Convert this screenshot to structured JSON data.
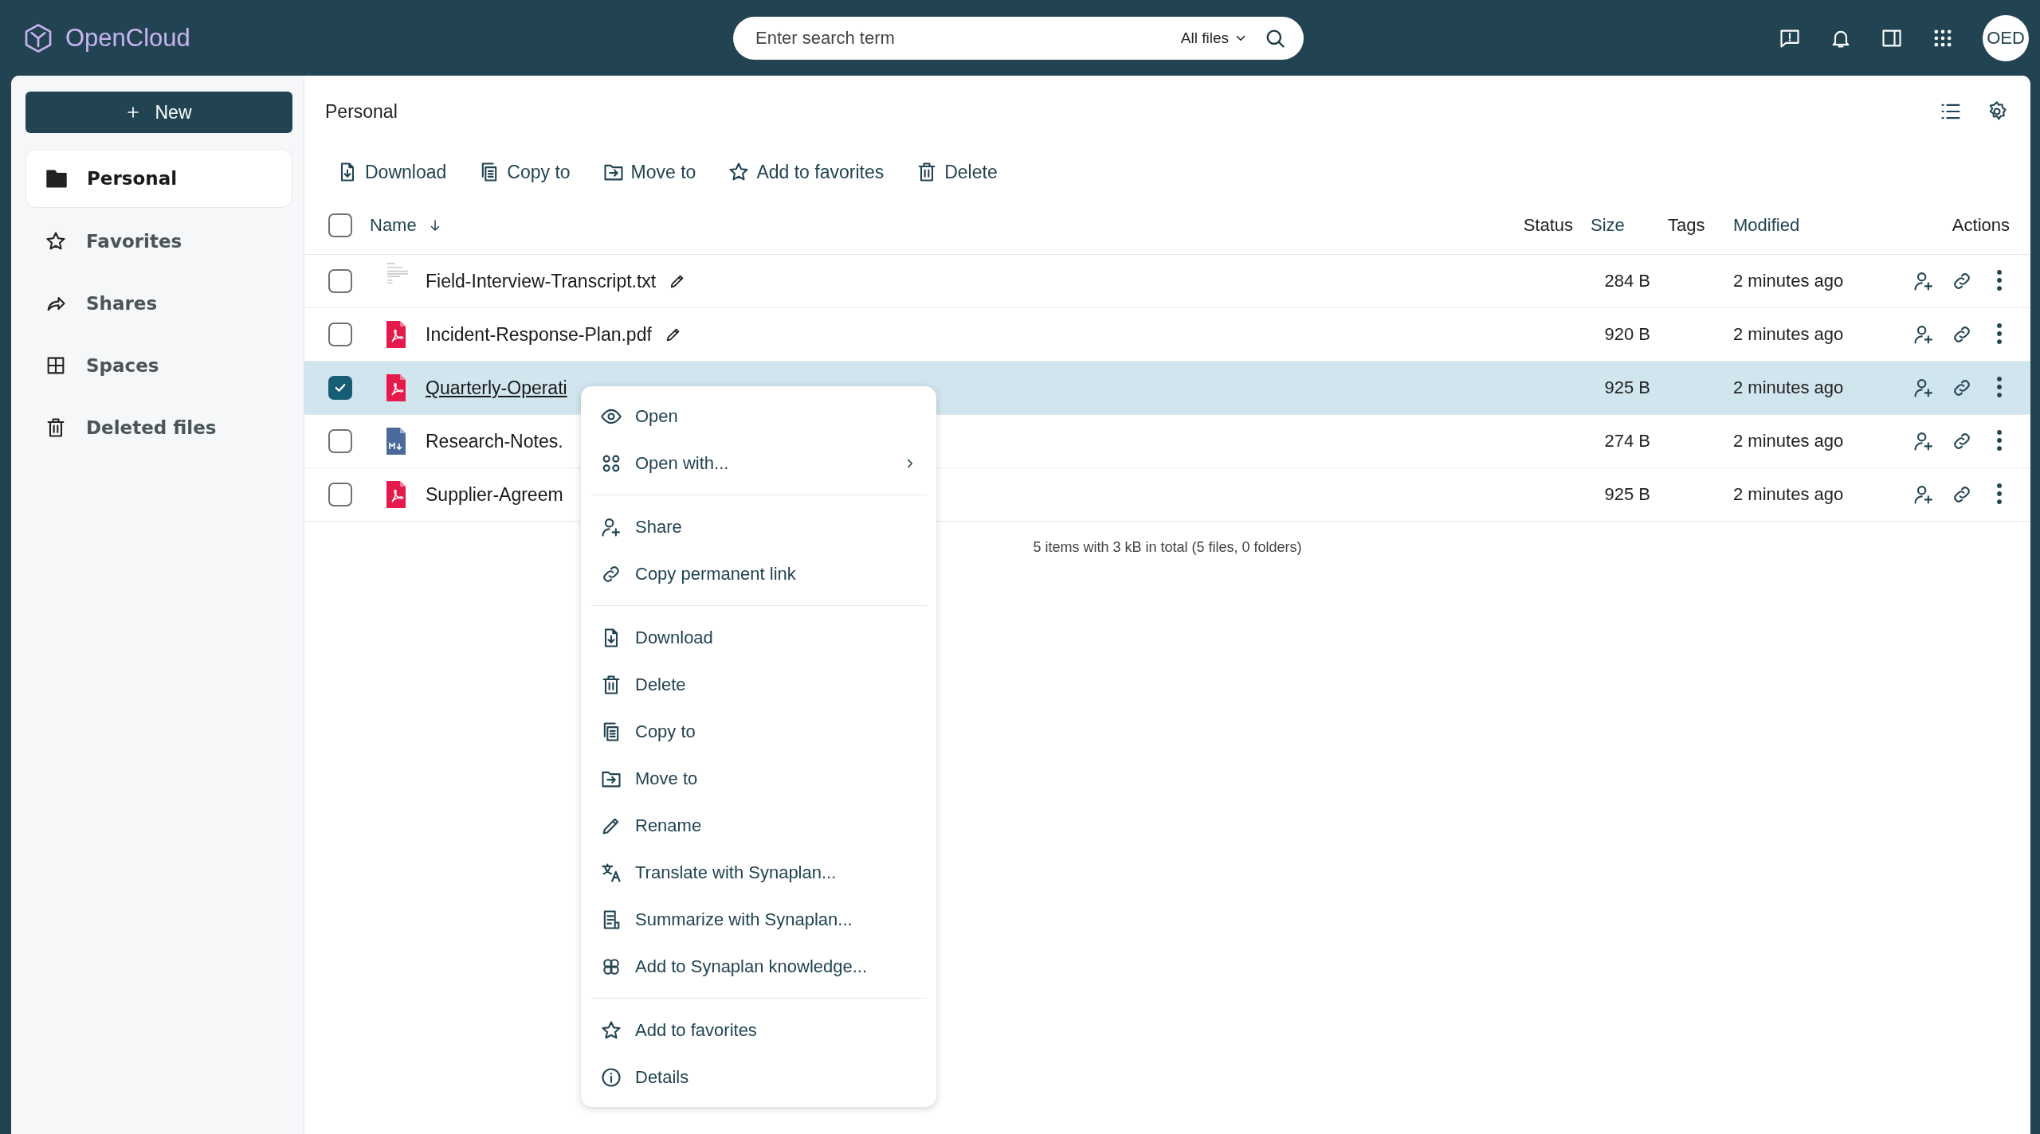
{
  "header": {
    "logo": "OpenCloud",
    "search": {
      "placeholder": "Enter search term",
      "scope": "All files"
    },
    "avatar": "OED"
  },
  "sidebar": {
    "new_button": "New",
    "items": [
      {
        "label": "Personal",
        "kind": "folder",
        "selected": true
      },
      {
        "label": "Favorites",
        "kind": "star",
        "selected": false
      },
      {
        "label": "Shares",
        "kind": "share",
        "selected": false
      },
      {
        "label": "Spaces",
        "kind": "grid",
        "selected": false
      },
      {
        "label": "Deleted files",
        "kind": "trash",
        "selected": false
      }
    ]
  },
  "breadcrumb": "Personal",
  "toolbar": [
    {
      "label": "Download",
      "kind": "download"
    },
    {
      "label": "Copy to",
      "kind": "copy"
    },
    {
      "label": "Move to",
      "kind": "move"
    },
    {
      "label": "Add to favorites",
      "kind": "star"
    },
    {
      "label": "Delete",
      "kind": "trash"
    }
  ],
  "table": {
    "all_selected": false,
    "columns": [
      {
        "label": "Name",
        "sortable": true,
        "sorted": true
      },
      {
        "label": "Status",
        "sortable": false,
        "sorted": false
      },
      {
        "label": "Size",
        "sortable": true,
        "sorted": false
      },
      {
        "label": "Tags",
        "sortable": false,
        "sorted": false
      },
      {
        "label": "Modified",
        "sortable": true,
        "sorted": false
      },
      {
        "label": "Actions",
        "sortable": false,
        "sorted": false
      }
    ],
    "rows": [
      {
        "name": "Field-Interview-Transcript.txt",
        "kind": "text",
        "editable": true,
        "selected": false,
        "size": "284 B",
        "modified": "2 minutes ago"
      },
      {
        "name": "Incident-Response-Plan.pdf",
        "kind": "pdf",
        "editable": true,
        "selected": false,
        "size": "920 B",
        "modified": "2 minutes ago"
      },
      {
        "name": "Quarterly-Operati",
        "kind": "pdf",
        "editable": false,
        "selected": true,
        "size": "925 B",
        "modified": "2 minutes ago"
      },
      {
        "name": "Research-Notes.",
        "kind": "markdown",
        "editable": false,
        "selected": false,
        "size": "274 B",
        "modified": "2 minutes ago"
      },
      {
        "name": "Supplier-Agreem",
        "kind": "pdf",
        "editable": false,
        "selected": false,
        "size": "925 B",
        "modified": "2 minutes ago"
      }
    ]
  },
  "footer": "5 items with 3 kB in total (5 files, 0 folders)",
  "context_menu": {
    "groups": [
      [
        {
          "label": "Open",
          "kind": "eye",
          "submenu": false
        },
        {
          "label": "Open with...",
          "kind": "apps",
          "submenu": true
        }
      ],
      [
        {
          "label": "Share",
          "kind": "share-user",
          "submenu": false
        },
        {
          "label": "Copy permanent link",
          "kind": "link",
          "submenu": false
        }
      ],
      [
        {
          "label": "Download",
          "kind": "download",
          "submenu": false
        },
        {
          "label": "Delete",
          "kind": "trash",
          "submenu": false
        },
        {
          "label": "Copy to",
          "kind": "copy",
          "submenu": false
        },
        {
          "label": "Move to",
          "kind": "move",
          "submenu": false
        },
        {
          "label": "Rename",
          "kind": "pencil",
          "submenu": false
        },
        {
          "label": "Translate with Synaplan...",
          "kind": "translate",
          "submenu": false
        },
        {
          "label": "Summarize with Synaplan...",
          "kind": "summarize",
          "submenu": false
        },
        {
          "label": "Add to Synaplan knowledge...",
          "kind": "knowledge",
          "submenu": false
        }
      ],
      [
        {
          "label": "Add to favorites",
          "kind": "star",
          "submenu": false
        },
        {
          "label": "Details",
          "kind": "info",
          "submenu": false
        }
      ]
    ]
  }
}
